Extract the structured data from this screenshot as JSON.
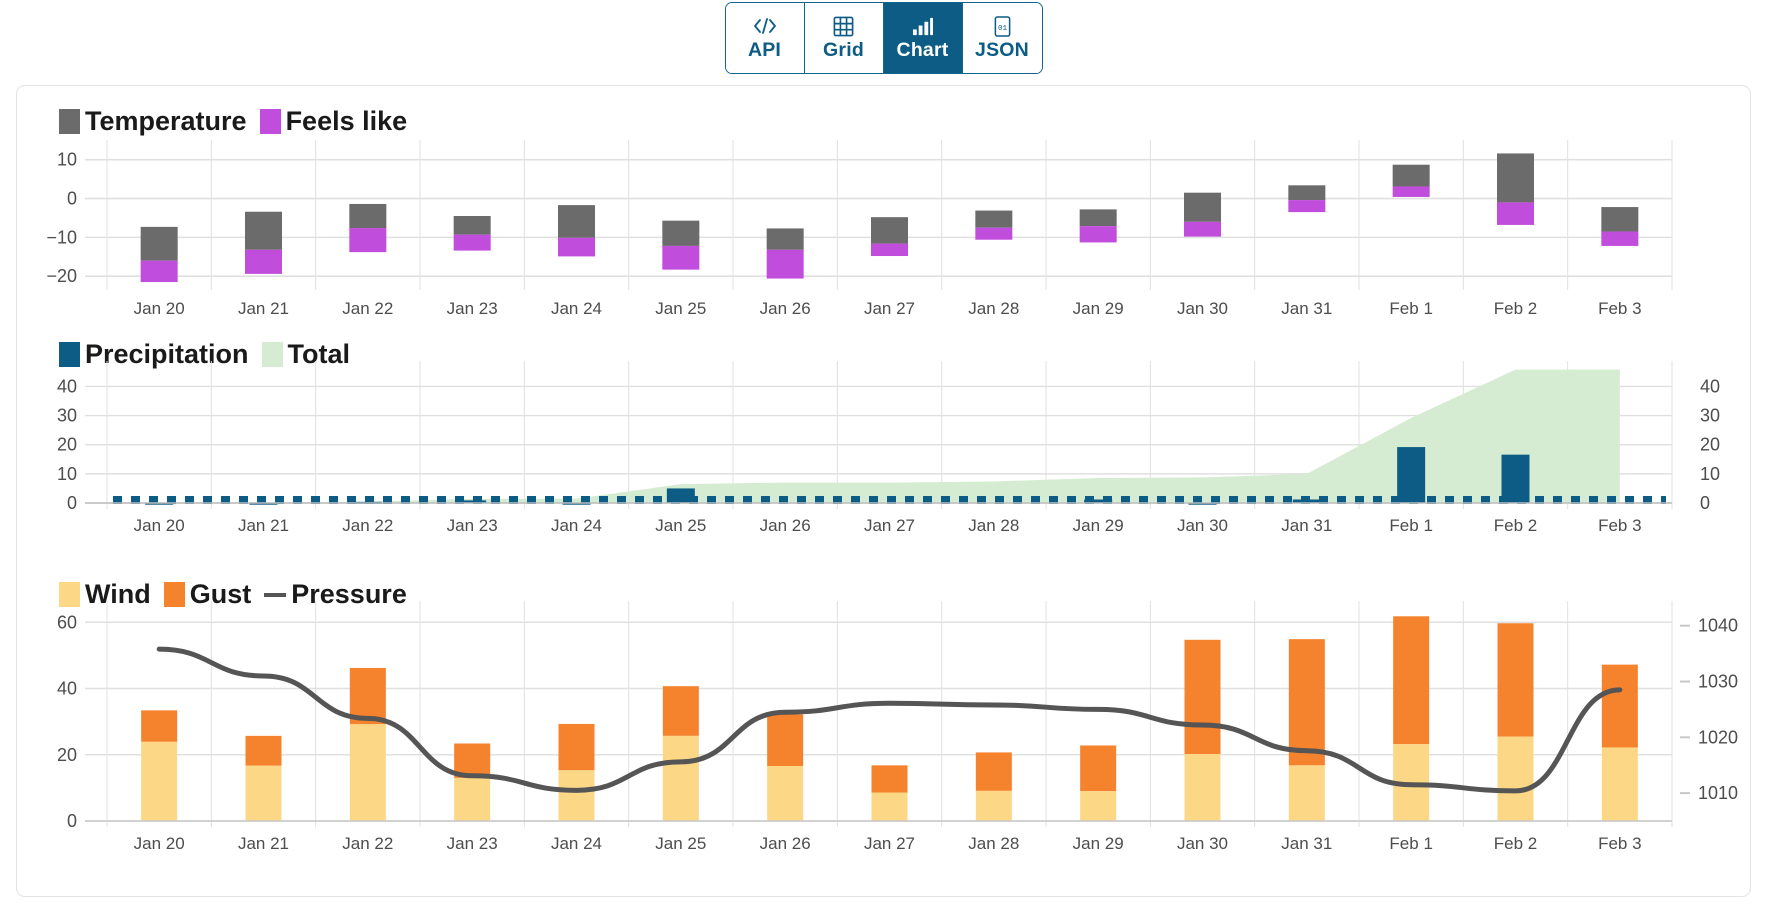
{
  "tabs": [
    {
      "label": "API",
      "icon": "code-icon",
      "active": false
    },
    {
      "label": "Grid",
      "icon": "grid-icon",
      "active": false
    },
    {
      "label": "Chart",
      "icon": "bar-chart-icon",
      "active": true
    },
    {
      "label": "JSON",
      "icon": "json-file-icon",
      "active": false
    }
  ],
  "colors": {
    "accent": "#0d5c85",
    "temperature": "#6b6b6b",
    "feels_like": "#c04ddc",
    "precipitation": "#0d5c85",
    "total": "#d6ecd2",
    "wind": "#fcd786",
    "gust": "#f5822c",
    "pressure": "#555555",
    "grid": "#e0e0e0",
    "axis_text": "#4d4d4d"
  },
  "categories": [
    "Jan 20",
    "Jan 21",
    "Jan 22",
    "Jan 23",
    "Jan 24",
    "Jan 25",
    "Jan 26",
    "Jan 27",
    "Jan 28",
    "Jan 29",
    "Jan 30",
    "Jan 31",
    "Feb 1",
    "Feb 2",
    "Feb 3"
  ],
  "chart_data": [
    {
      "type": "bar",
      "id": "temperature-chart",
      "title": "",
      "xlabel": "",
      "ylabel": "",
      "ylim": [
        -22,
        13
      ],
      "yticks": [
        10,
        0,
        -10,
        -20
      ],
      "grid": true,
      "legend_position": "top-left",
      "legend": [
        "Temperature",
        "Feels like"
      ],
      "categories": [
        "Jan 20",
        "Jan 21",
        "Jan 22",
        "Jan 23",
        "Jan 24",
        "Jan 25",
        "Jan 26",
        "Jan 27",
        "Jan 28",
        "Jan 29",
        "Jan 30",
        "Jan 31",
        "Feb 1",
        "Feb 2",
        "Feb 3"
      ],
      "series": [
        {
          "name": "Temperature",
          "kind": "range",
          "low": [
            -13.0,
            -16.3,
            -13.8,
            -13.4,
            -14.9,
            -18.3,
            -20.6,
            -14.8,
            -10.6,
            -11.3,
            -9.8,
            -3.5,
            0.4,
            -6.8,
            -12.2
          ],
          "high": [
            -7.3,
            -3.4,
            -1.4,
            -4.5,
            -1.7,
            -5.7,
            -7.7,
            -4.8,
            -3.1,
            -2.8,
            1.5,
            3.4,
            8.7,
            11.6,
            -2.2
          ]
        },
        {
          "name": "Feels like",
          "kind": "range",
          "low": [
            -21.5,
            -19.4,
            -13.8,
            -13.4,
            -14.9,
            -18.3,
            -20.6,
            -14.8,
            -10.6,
            -11.3,
            -9.8,
            -3.5,
            0.4,
            -6.8,
            -12.2
          ],
          "high": [
            -16.0,
            -13.2,
            -7.6,
            -9.3,
            -10.1,
            -12.2,
            -13.2,
            -11.6,
            -7.5,
            -7.1,
            -6.0,
            -0.4,
            3.1,
            -1.0,
            -8.5
          ]
        }
      ]
    },
    {
      "type": "bar",
      "id": "precipitation-chart",
      "title": "",
      "xlabel": "",
      "ylabel": "",
      "ylim": [
        0,
        46
      ],
      "yticks": [
        40,
        30,
        20,
        10,
        0
      ],
      "y2ticks": [
        40,
        30,
        20,
        10,
        0
      ],
      "grid": true,
      "legend_position": "top-left",
      "legend": [
        "Precipitation",
        "Total"
      ],
      "categories": [
        "Jan 20",
        "Jan 21",
        "Jan 22",
        "Jan 23",
        "Jan 24",
        "Jan 25",
        "Jan 26",
        "Jan 27",
        "Jan 28",
        "Jan 29",
        "Jan 30",
        "Jan 31",
        "Feb 1",
        "Feb 2",
        "Feb 3"
      ],
      "series": [
        {
          "name": "Precipitation",
          "kind": "bar",
          "values": [
            0.1,
            0.1,
            0.4,
            0.9,
            0.1,
            5.0,
            0.0,
            0.0,
            0.0,
            1.2,
            0.1,
            1.2,
            19.2,
            16.6,
            0.0
          ]
        },
        {
          "name": "Total",
          "kind": "area",
          "values": [
            0.0,
            0.1,
            0.5,
            1.4,
            1.5,
            6.5,
            7.0,
            7.0,
            7.4,
            8.6,
            8.8,
            10.0,
            29.2,
            45.8,
            45.8
          ]
        },
        {
          "name": "baseline",
          "kind": "dotted-line",
          "values": [
            0,
            0,
            0,
            0,
            0,
            0,
            0,
            0,
            0,
            0,
            0,
            0,
            0,
            0,
            0
          ]
        }
      ]
    },
    {
      "type": "bar",
      "id": "wind-chart",
      "title": "",
      "xlabel": "",
      "ylabel": "",
      "ylim": [
        0,
        64
      ],
      "yticks": [
        60,
        40,
        20,
        0
      ],
      "y2label": "Pressure",
      "y2lim": [
        1005,
        1043
      ],
      "y2ticks": [
        1040,
        1030,
        1020,
        1010
      ],
      "grid": true,
      "legend_position": "top-left",
      "legend": [
        "Wind",
        "Gust",
        "Pressure"
      ],
      "categories": [
        "Jan 20",
        "Jan 21",
        "Jan 22",
        "Jan 23",
        "Jan 24",
        "Jan 25",
        "Jan 26",
        "Jan 27",
        "Jan 28",
        "Jan 29",
        "Jan 30",
        "Jan 31",
        "Feb 1",
        "Feb 2",
        "Feb 3"
      ],
      "series": [
        {
          "name": "Wind",
          "kind": "bar-stack",
          "values": [
            23.9,
            16.7,
            29.2,
            13.0,
            15.3,
            25.7,
            16.6,
            8.6,
            9.1,
            9.0,
            20.2,
            16.8,
            23.2,
            25.5,
            22.2
          ]
        },
        {
          "name": "Gust",
          "kind": "bar-stack",
          "values": [
            9.5,
            9.0,
            17.0,
            10.4,
            14.0,
            15.0,
            15.6,
            8.2,
            11.6,
            13.8,
            34.5,
            38.1,
            38.6,
            34.2,
            25.0
          ]
        },
        {
          "name": "Pressure",
          "kind": "line",
          "values": [
            1035.8,
            1031.0,
            1023.4,
            1013.1,
            1010.5,
            1015.6,
            1024.5,
            1026.1,
            1025.8,
            1025.0,
            1022.2,
            1017.6,
            1011.5,
            1010.4,
            1028.5
          ]
        }
      ]
    }
  ]
}
